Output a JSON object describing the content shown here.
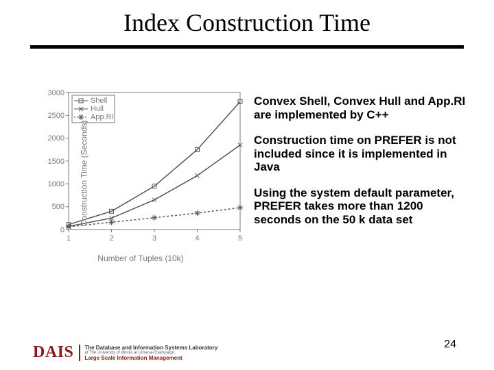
{
  "title": "Index Construction Time",
  "page_number": "24",
  "logo": {
    "mark": "DAIS",
    "line1": "The Database and Information Systems Laboratory",
    "line1a": "at The University of Illinois at Urbana-Champaign",
    "line2": "Large Scale Information Management"
  },
  "bullets": [
    "Convex Shell, Convex Hull and App.RI are implemented by C++",
    "Construction time on PREFER is not included since it is implemented in Java",
    "Using the system default parameter, PREFER takes more than 1200 seconds on the 50 k data set"
  ],
  "chart": {
    "ylabel": "Construction Time (Seconds)",
    "xlabel": "Number of Tuples (10k)",
    "y_ticks": [
      "0",
      "500",
      "1000",
      "1500",
      "2000",
      "2500",
      "3000"
    ],
    "x_ticks": [
      "1",
      "2",
      "3",
      "4",
      "5"
    ],
    "legend": [
      "Shell",
      "Hull",
      "App.RI"
    ]
  },
  "chart_data": {
    "type": "line",
    "title": "",
    "xlabel": "Number of Tuples (10k)",
    "ylabel": "Construction Time (Seconds)",
    "xlim": [
      1,
      5
    ],
    "ylim": [
      0,
      3000
    ],
    "x": [
      1,
      2,
      3,
      4,
      5
    ],
    "series": [
      {
        "name": "Shell",
        "marker": "square",
        "values": [
          110,
          400,
          950,
          1750,
          2800
        ]
      },
      {
        "name": "Hull",
        "marker": "x",
        "values": [
          70,
          250,
          650,
          1180,
          1850
        ]
      },
      {
        "name": "App.RI",
        "marker": "asterisk",
        "values": [
          60,
          160,
          260,
          360,
          480
        ]
      }
    ]
  }
}
